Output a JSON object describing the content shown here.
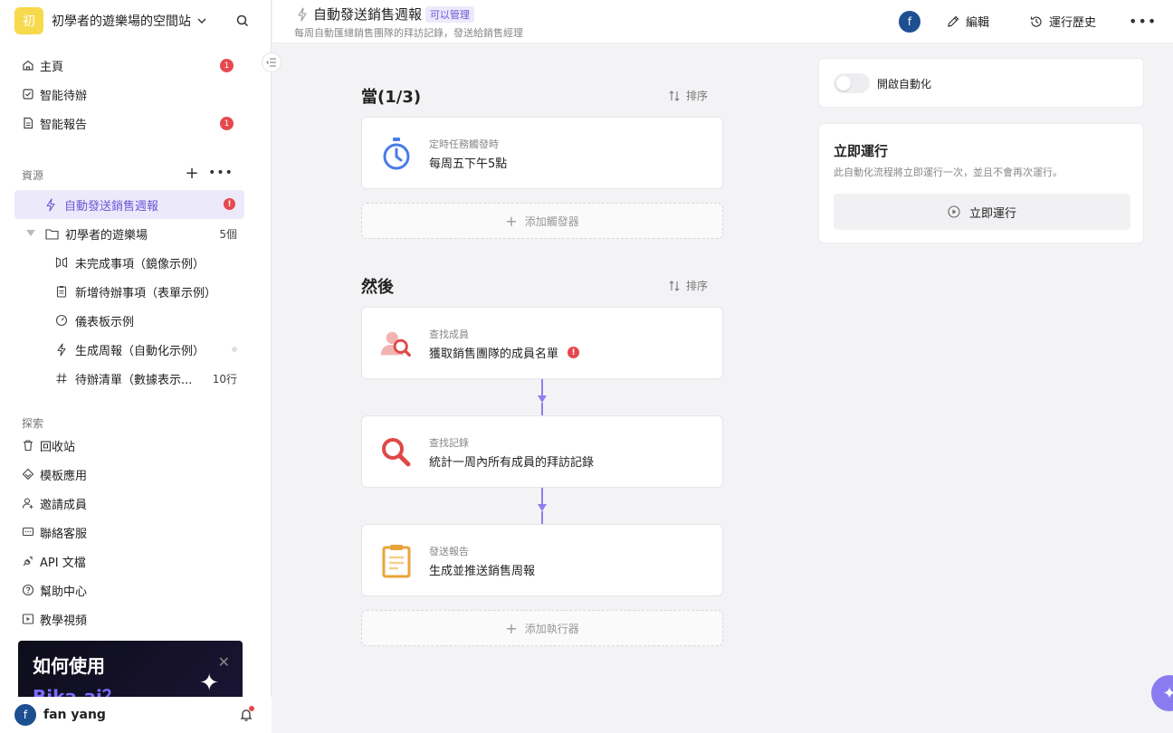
{
  "workspace": {
    "logo_char": "初",
    "name": "初學者的遊樂場的空間站"
  },
  "nav": [
    {
      "label": "主頁",
      "badge": "1"
    },
    {
      "label": "智能待辦",
      "badge": ""
    },
    {
      "label": "智能報告",
      "badge": "1"
    }
  ],
  "resources": {
    "section_label": "資源",
    "active_item": "自動發送銷售週報",
    "folder": {
      "label": "初學者的遊樂場",
      "count": "5個"
    },
    "children": [
      {
        "label": "未完成事項（鏡像示例）",
        "icon": "mirror-icon"
      },
      {
        "label": "新增待辦事項（表單示例）",
        "icon": "form-icon"
      },
      {
        "label": "儀表板示例",
        "icon": "dashboard-icon"
      },
      {
        "label": "生成周報（自動化示例）",
        "icon": "bolt-icon"
      },
      {
        "label": "待辦清單（數據表示...",
        "icon": "hash-icon",
        "count": "10行"
      }
    ]
  },
  "explore": {
    "section_label": "探索",
    "items": [
      {
        "label": "回收站",
        "icon": "trash-icon"
      },
      {
        "label": "模板應用",
        "icon": "template-icon"
      },
      {
        "label": "邀請成員",
        "icon": "invite-icon"
      },
      {
        "label": "聯絡客服",
        "icon": "support-icon"
      },
      {
        "label": "API 文檔",
        "icon": "api-icon"
      },
      {
        "label": "幫助中心",
        "icon": "help-icon"
      },
      {
        "label": "教學視頻",
        "icon": "video-icon"
      }
    ]
  },
  "promo": {
    "title": "如何使用",
    "subtitle": "Bika.ai？"
  },
  "user": {
    "avatar_char": "f",
    "name": "fan yang"
  },
  "header": {
    "title": "自動發送銷售週報",
    "permission": "可以管理",
    "subtitle": "每周自動匯總銷售團隊的拜訪記錄，發送給銷售經理",
    "avatar_char": "f",
    "edit_label": "編輯",
    "history_label": "運行歷史"
  },
  "trigger_section": {
    "title": "當(1/3)",
    "sort_label": "排序",
    "card": {
      "label": "定時任務觸發時",
      "value": "每周五下午5點"
    },
    "add_label": "添加觸發器"
  },
  "action_section": {
    "title": "然後",
    "sort_label": "排序",
    "cards": [
      {
        "label": "查找成員",
        "value": "獲取銷售團隊的成員名單",
        "error": "!"
      },
      {
        "label": "查找記錄",
        "value": "統計一周內所有成員的拜訪記錄"
      },
      {
        "label": "發送報告",
        "value": "生成並推送銷售周報"
      }
    ],
    "add_label": "添加執行器"
  },
  "automation_panel": {
    "toggle_label": "開啟自動化",
    "enabled": false
  },
  "run_panel": {
    "title": "立即運行",
    "description": "此自動化流程將立即運行一次，並且不會再次運行。",
    "button_label": "立即運行"
  },
  "colors": {
    "accent": "#6b57d6",
    "badge_red": "#e5484d",
    "connector": "#8c7ff0",
    "workspace_logo": "#f7d94c"
  }
}
